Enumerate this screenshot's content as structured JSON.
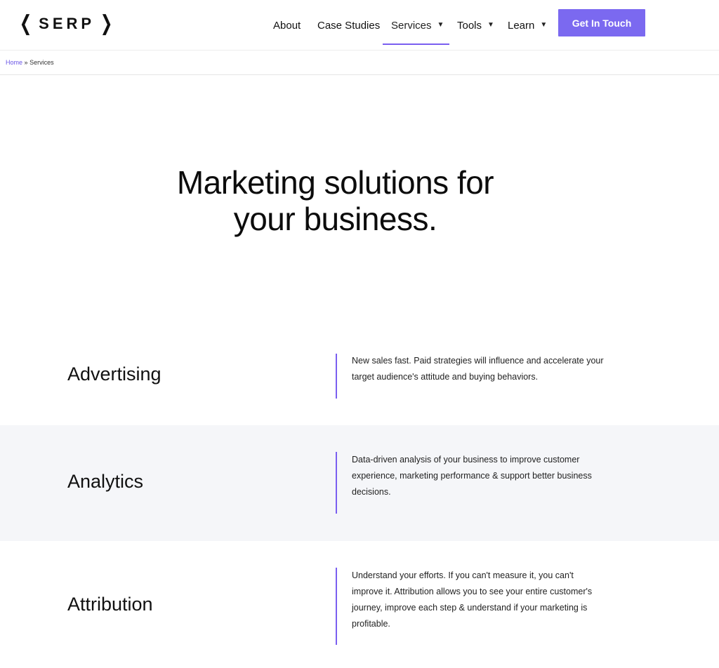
{
  "header": {
    "logo": {
      "left_bracket": "❮",
      "text": "SERP",
      "right_bracket": "❯"
    },
    "nav": [
      {
        "label": "About",
        "has_dropdown": false
      },
      {
        "label": "Case Studies",
        "has_dropdown": false
      },
      {
        "label": "Services",
        "has_dropdown": true,
        "active": true
      },
      {
        "label": "Tools",
        "has_dropdown": true
      },
      {
        "label": "Learn",
        "has_dropdown": true
      }
    ],
    "chevron": "⌄",
    "cta_label": "Get In Touch",
    "accent_color": "#7b69f0"
  },
  "breadcrumb": {
    "home": "Home",
    "separator": "»",
    "current": "Services"
  },
  "hero": {
    "line1": "Marketing solutions for",
    "line2": "your business."
  },
  "services": [
    {
      "title": "Advertising",
      "lines": [
        "New sales fast. Paid strategies will influence and accelerate your",
        "target audience's attitude and buying behaviors."
      ]
    },
    {
      "title": "Analytics",
      "lines": [
        "Data-driven analysis of your business to improve customer",
        "experience, marketing performance & support better business",
        "decisions."
      ]
    },
    {
      "title": "Attribution",
      "lines": [
        "Understand your efforts. If you can't measure it, you can't",
        "improve it. Attribution allows you to see your entire customer's",
        "journey, improve each step & understand if your marketing is",
        "profitable."
      ]
    }
  ]
}
